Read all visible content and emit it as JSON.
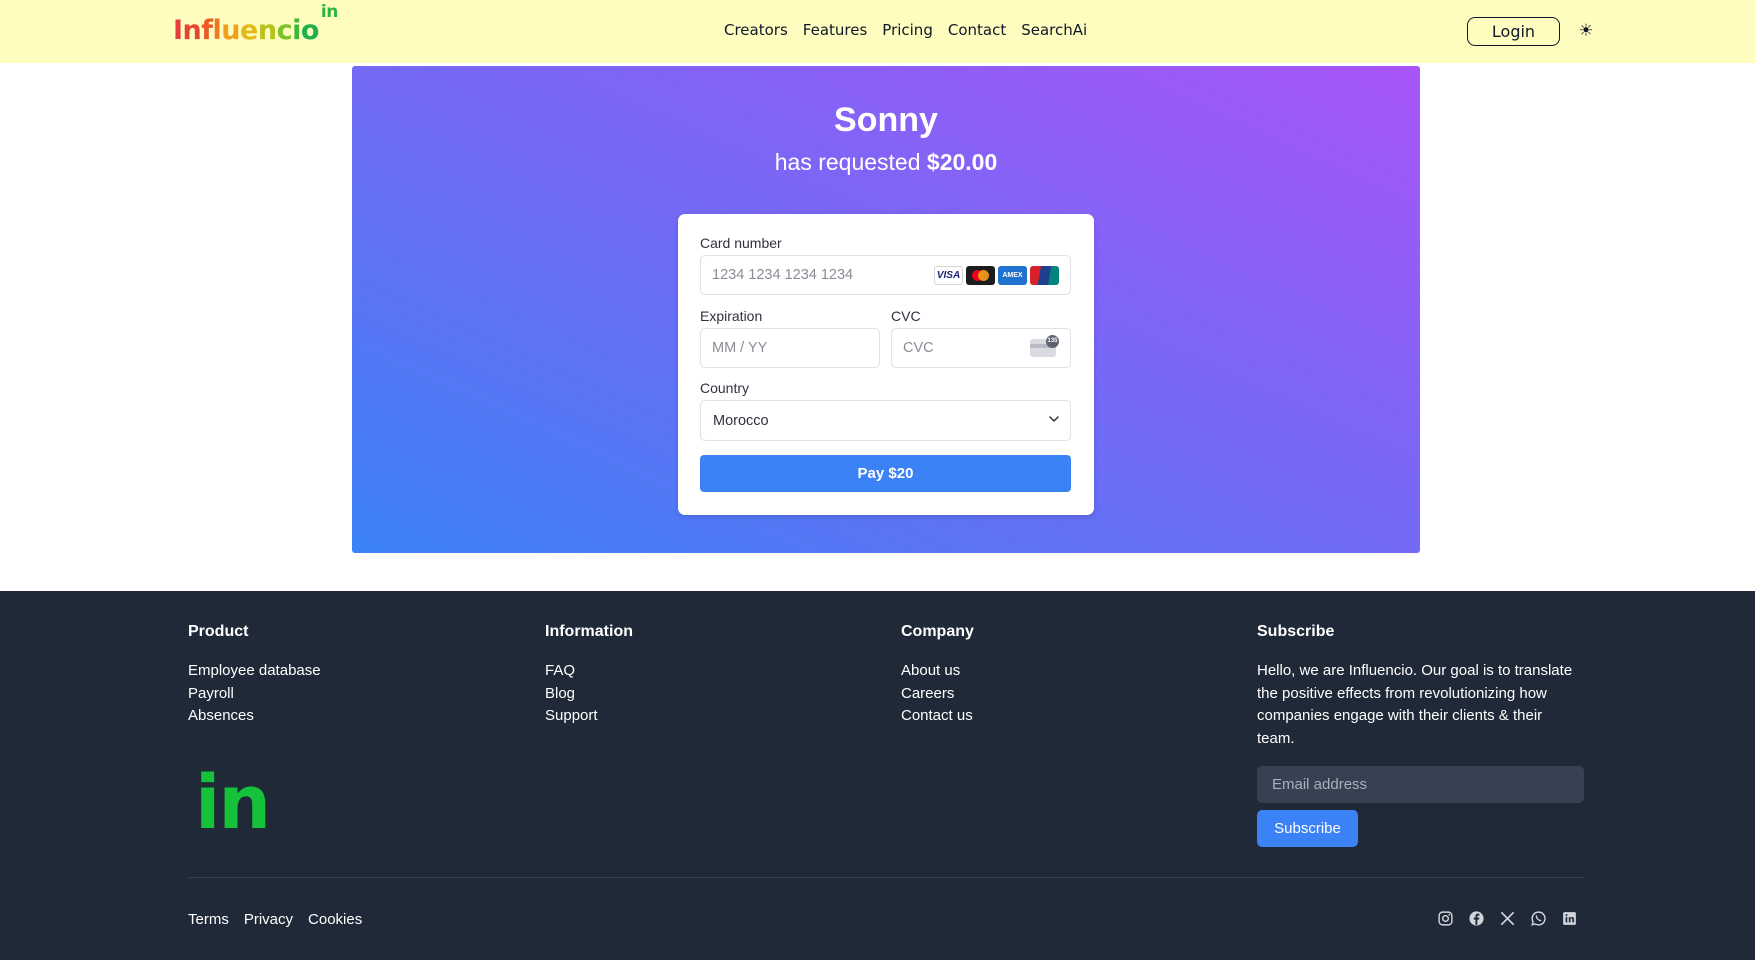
{
  "header": {
    "logo": {
      "letters": [
        "I",
        "n",
        "f",
        "l",
        "u",
        "e",
        "n",
        "c",
        "i",
        "o"
      ],
      "letter_colors": [
        "#e53e3e",
        "#e6452f",
        "#ea5a25",
        "#ee7a1e",
        "#efa11b",
        "#e2ba18",
        "#b8c21b",
        "#7dc226",
        "#3fb835",
        "#1fb04a"
      ],
      "superscript": "in",
      "superscript_color": "#2bb53d"
    },
    "nav": [
      "Creators",
      "Features",
      "Pricing",
      "Contact",
      "SearchAi"
    ],
    "login_label": "Login",
    "theme_toggle": "☀"
  },
  "payment": {
    "requester": "Sonny",
    "request_prefix": "has requested",
    "amount": "$20.00",
    "card_number_label": "Card number",
    "card_number_placeholder": "1234 1234 1234 1234",
    "card_brands": [
      "VISA",
      "Mastercard",
      "AMEX",
      "UnionPay"
    ],
    "card_brand_icons": [
      "visa-icon",
      "mastercard-icon",
      "amex-icon",
      "unionpay-icon"
    ],
    "expiration_label": "Expiration",
    "expiration_placeholder": "MM / YY",
    "cvc_label": "CVC",
    "cvc_placeholder": "CVC",
    "cvc_icon_text": "135",
    "country_label": "Country",
    "country_value": "Morocco",
    "pay_label": "Pay $20"
  },
  "footer": {
    "columns": [
      {
        "title": "Product",
        "links": [
          "Employee database",
          "Payroll",
          "Absences"
        ]
      },
      {
        "title": "Information",
        "links": [
          "FAQ",
          "Blog",
          "Support"
        ]
      },
      {
        "title": "Company",
        "links": [
          "About us",
          "Careers",
          "Contact us"
        ]
      }
    ],
    "subscribe": {
      "title": "Subscribe",
      "text": "Hello, we are Influencio. Our goal is to translate the positive effects from revolutionizing how companies engage with their clients & their team.",
      "email_placeholder": "Email address",
      "button_label": "Subscribe"
    },
    "logo_text": "in",
    "legal_links": [
      "Terms",
      "Privacy",
      "Cookies"
    ],
    "socials": [
      "instagram-icon",
      "facebook-icon",
      "x-icon",
      "whatsapp-icon",
      "linkedin-icon"
    ]
  },
  "colors": {
    "header_bg": "#fefcbf",
    "gradient_start": "#3b82f6",
    "gradient_end": "#a855f7",
    "accent": "#3b82f6",
    "footer_bg": "#1f2937",
    "footer_logo": "#16c23a"
  }
}
